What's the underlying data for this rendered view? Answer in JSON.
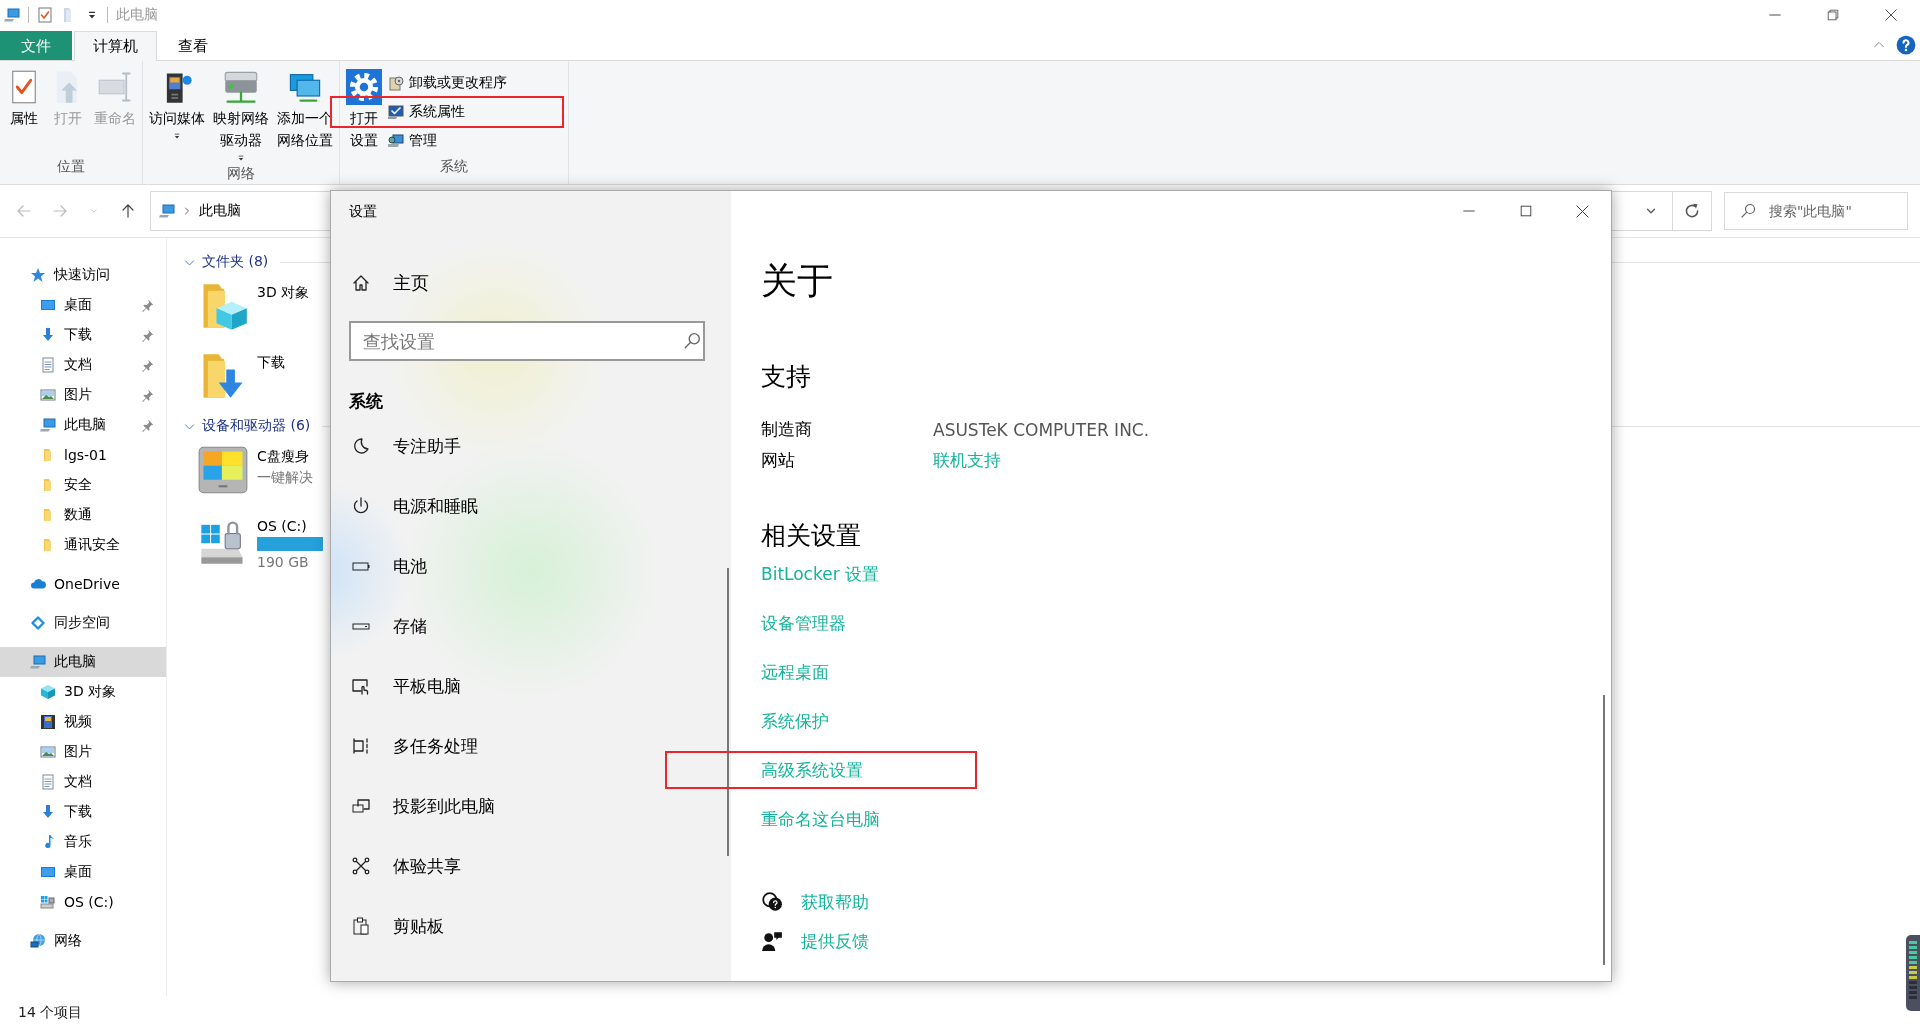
{
  "title_bar": {
    "title": "此电脑"
  },
  "ribbon_tabs": [
    {
      "label": "文件",
      "kind": "file",
      "selected": false
    },
    {
      "label": "计算机",
      "kind": "tab",
      "selected": true
    },
    {
      "label": "查看",
      "kind": "tab",
      "selected": false
    }
  ],
  "ribbon_groups": [
    {
      "label": "位置",
      "buttons": [
        {
          "lines": [
            "属性"
          ],
          "kind": "properties",
          "disabled": false,
          "has_menu": false
        },
        {
          "lines": [
            "打开"
          ],
          "kind": "open",
          "disabled": true,
          "has_menu": false
        },
        {
          "lines": [
            "重命名"
          ],
          "kind": "rename",
          "disabled": true,
          "has_menu": false
        }
      ]
    },
    {
      "label": "网络",
      "buttons": [
        {
          "lines": [
            "访问媒体"
          ],
          "kind": "media",
          "disabled": false,
          "has_menu": true
        },
        {
          "lines": [
            "映射网络",
            "驱动器"
          ],
          "kind": "map-drive",
          "disabled": false,
          "has_menu": true
        },
        {
          "lines": [
            "添加一个",
            "网络位置"
          ],
          "kind": "add-location",
          "disabled": false,
          "has_menu": false
        }
      ]
    },
    {
      "label": "系统",
      "buttons": [
        {
          "lines": [
            "打开",
            "设置"
          ],
          "kind": "gear-settings",
          "disabled": false,
          "has_menu": false
        }
      ],
      "small_buttons": [
        {
          "label": "卸载或更改程序",
          "kind": "uninstall",
          "annotated": false
        },
        {
          "label": "系统属性",
          "kind": "sys-props",
          "annotated": true
        },
        {
          "label": "管理",
          "kind": "manage",
          "annotated": false
        }
      ]
    }
  ],
  "address_bar": {
    "path": [
      "此电脑"
    ]
  },
  "search": {
    "placeholder": "搜索\"此电脑\""
  },
  "nav_pane": {
    "items": [
      {
        "label": "快速访问",
        "kind": "star",
        "selected": false,
        "children": [
          {
            "label": "桌面",
            "kind": "desktop",
            "selected": false,
            "pinned": true
          },
          {
            "label": "下载",
            "kind": "download",
            "selected": false,
            "pinned": true
          },
          {
            "label": "文档",
            "kind": "document",
            "selected": false,
            "pinned": true
          },
          {
            "label": "图片",
            "kind": "pictures",
            "selected": false,
            "pinned": true
          },
          {
            "label": "此电脑",
            "kind": "pc",
            "selected": false,
            "pinned": true
          },
          {
            "label": "lgs-01",
            "kind": "folder",
            "selected": false,
            "pinned": false
          },
          {
            "label": "安全",
            "kind": "folder",
            "selected": false,
            "pinned": false
          },
          {
            "label": "数通",
            "kind": "folder",
            "selected": false,
            "pinned": false
          },
          {
            "label": "通讯安全",
            "kind": "folder",
            "selected": false,
            "pinned": false
          }
        ]
      },
      {
        "label": "OneDrive",
        "kind": "cloud",
        "selected": false
      },
      {
        "label": "同步空间",
        "kind": "sync",
        "selected": false
      },
      {
        "label": "此电脑",
        "kind": "pc",
        "selected": true,
        "children": [
          {
            "label": "3D 对象",
            "kind": "cube",
            "selected": false,
            "pinned": false
          },
          {
            "label": "视频",
            "kind": "video",
            "selected": false,
            "pinned": false
          },
          {
            "label": "图片",
            "kind": "pictures",
            "selected": false,
            "pinned": false
          },
          {
            "label": "文档",
            "kind": "document",
            "selected": false,
            "pinned": false
          },
          {
            "label": "下载",
            "kind": "download",
            "selected": false,
            "pinned": false
          },
          {
            "label": "音乐",
            "kind": "music",
            "selected": false,
            "pinned": false
          },
          {
            "label": "桌面",
            "kind": "desktop",
            "selected": false,
            "pinned": false
          },
          {
            "label": "OS (C:)",
            "kind": "drive",
            "selected": false,
            "pinned": false
          }
        ]
      },
      {
        "label": "网络",
        "kind": "network",
        "selected": false
      }
    ]
  },
  "content_groups": [
    {
      "label": "文件夹 (8)",
      "expanded": true,
      "items": [
        {
          "name": "3D 对象",
          "kind": "folder-cube"
        },
        {
          "name": "下载",
          "kind": "folder-download"
        }
      ]
    },
    {
      "label": "设备和驱动器 (6)",
      "expanded": true,
      "items": [
        {
          "name": "C盘瘦身",
          "kind": "app-drive",
          "detail": "一键解决"
        },
        {
          "name": "OS (C:)",
          "kind": "os-drive",
          "level": 1,
          "detail": "190 GB"
        }
      ]
    }
  ],
  "status_bar": {
    "count": "14 个项目"
  },
  "settings": {
    "title": "设置",
    "home": "主页",
    "search_placeholder": "查找设置",
    "section": "系统",
    "menu": [
      {
        "label": "专注助手",
        "kind": "moon"
      },
      {
        "label": "电源和睡眠",
        "kind": "power"
      },
      {
        "label": "电池",
        "kind": "battery"
      },
      {
        "label": "存储",
        "kind": "storage"
      },
      {
        "label": "平板电脑",
        "kind": "tablet"
      },
      {
        "label": "多任务处理",
        "kind": "multitask"
      },
      {
        "label": "投影到此电脑",
        "kind": "project"
      },
      {
        "label": "体验共享",
        "kind": "share"
      },
      {
        "label": "剪贴板",
        "kind": "clipboard"
      }
    ],
    "page_title": "关于",
    "support": {
      "heading": "支持",
      "rows": [
        {
          "label": "制造商",
          "value": "ASUSTeK COMPUTER INC.",
          "kind": "text"
        },
        {
          "label": "网站",
          "value": "联机支持",
          "kind": "link"
        }
      ]
    },
    "related": {
      "heading": "相关设置",
      "links": [
        {
          "label": "BitLocker 设置",
          "annotated": false
        },
        {
          "label": "设备管理器",
          "annotated": false
        },
        {
          "label": "远程桌面",
          "annotated": false
        },
        {
          "label": "系统保护",
          "annotated": false
        },
        {
          "label": "高级系统设置",
          "annotated": true
        },
        {
          "label": "重命名这台电脑",
          "annotated": false
        }
      ]
    },
    "help_links": [
      {
        "label": "获取帮助",
        "kind": "help"
      },
      {
        "label": "提供反馈",
        "kind": "feedback"
      }
    ]
  }
}
